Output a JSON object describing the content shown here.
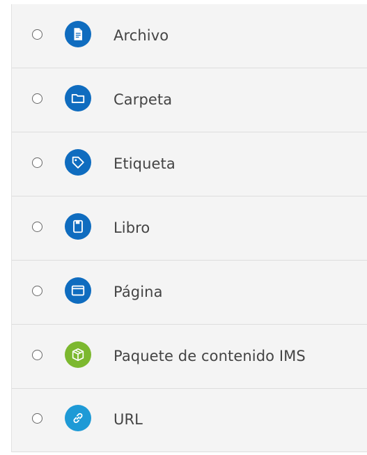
{
  "options": [
    {
      "label": "Archivo",
      "icon": "file-icon",
      "color": "#0f6cbf"
    },
    {
      "label": "Carpeta",
      "icon": "folder-icon",
      "color": "#0f6cbf"
    },
    {
      "label": "Etiqueta",
      "icon": "tag-icon",
      "color": "#0f6cbf"
    },
    {
      "label": "Libro",
      "icon": "book-icon",
      "color": "#0f6cbf"
    },
    {
      "label": "Página",
      "icon": "page-window-icon",
      "color": "#0f6cbf"
    },
    {
      "label": "Paquete de contenido IMS",
      "icon": "package-box-icon",
      "color": "#7cb82f"
    },
    {
      "label": "URL",
      "icon": "link-icon",
      "color": "#1e9ad6"
    }
  ]
}
